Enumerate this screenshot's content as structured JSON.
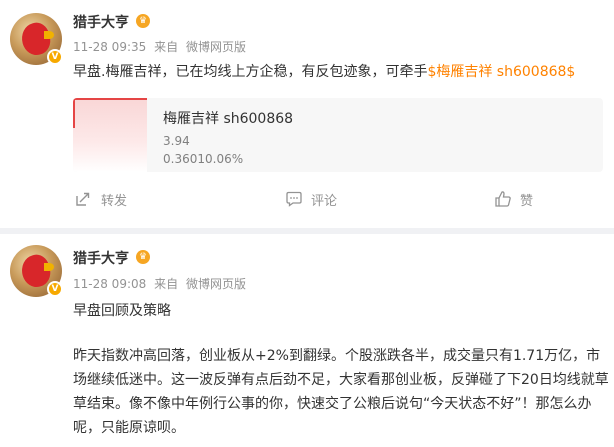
{
  "posts": [
    {
      "author": "猎手大亨",
      "date": "11-28 09:35",
      "source_prefix": "来自",
      "source": "微博网页版",
      "text_main": "早盘.梅雁吉祥，已在均线上方企稳，有反包迹象，可牵手",
      "stock_tag": "$梅雁吉祥 sh600868$",
      "stock_card": {
        "name": "梅雁吉祥 sh600868",
        "price": "3.94",
        "change": "0.36010.06%"
      },
      "actions": {
        "repost": "转发",
        "comment": "评论",
        "like": "赞"
      }
    },
    {
      "author": "猎手大亨",
      "date": "11-28 09:08",
      "source_prefix": "来自",
      "source": "微博网页版",
      "title": "早盘回顾及策略",
      "body": "昨天指数冲高回落，创业板从+2%到翻绿。个股涨跌各半，成交量只有1.71万亿，市场继续低迷中。这一波反弹有点后劲不足，大家看那创业板，反弹碰了下20日均线就草草结束。像不像中年例行公事的你，快速交了公粮后说句“今天状态不好”！那怎么办呢，只能原谅呗。"
    }
  ],
  "colors": {
    "accent": "#ff8200",
    "meta": "#939393",
    "verified": "#f7a900"
  }
}
